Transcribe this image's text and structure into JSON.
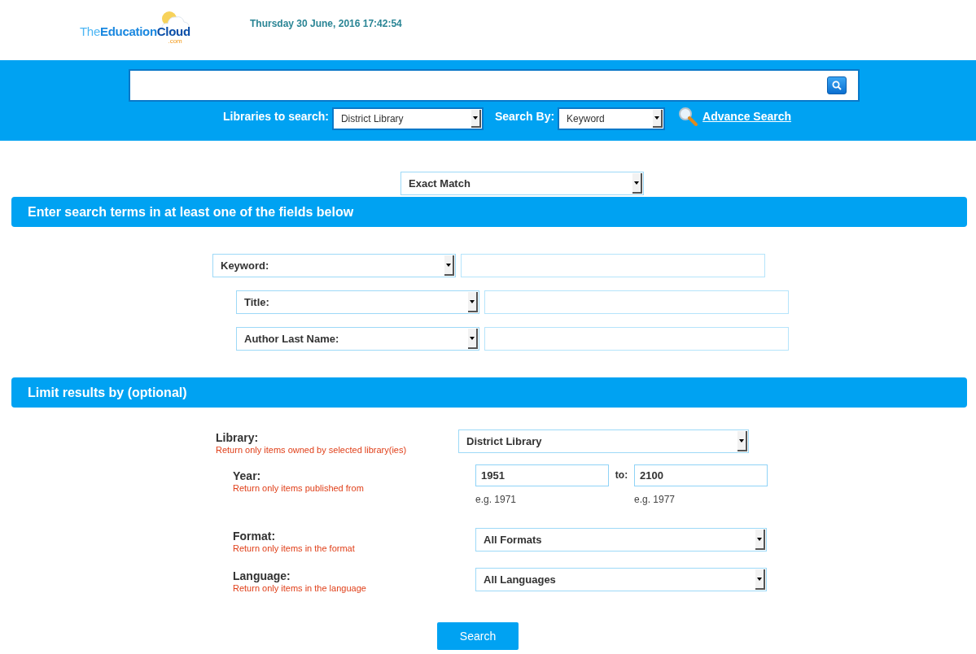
{
  "header": {
    "logo": {
      "parts": [
        "The",
        "Education",
        "Cloud"
      ],
      "suffix": ".com"
    },
    "datetime": "Thursday 30 June, 2016 17:42:54"
  },
  "search_bar": {
    "libraries_label": "Libraries to search:",
    "libraries_value": "District Library",
    "search_by_label": "Search By:",
    "search_by_value": "Keyword",
    "advance_search_link": "Advance Search"
  },
  "match_mode": "Exact Match",
  "terms_section": {
    "title": "Enter search terms in at least one of the fields below",
    "fields": [
      {
        "field": "Keyword:"
      },
      {
        "field": "Title:"
      },
      {
        "field": "Author Last Name:"
      }
    ]
  },
  "limits_section": {
    "title": "Limit results by (optional)",
    "rows": [
      {
        "kind": "select",
        "label": "Library:",
        "hint": "Return only items owned by selected library(ies)",
        "value": "District Library"
      },
      {
        "kind": "range",
        "label": "Year:",
        "hint": "Return only items published from",
        "from": "1951",
        "separator": "to:",
        "to": "2100",
        "from_example": "e.g. 1971",
        "to_example": "e.g. 1977"
      },
      {
        "kind": "select",
        "label": "Format:",
        "hint": "Return only items in the format",
        "value": "All Formats"
      },
      {
        "kind": "select",
        "label": "Language:",
        "hint": "Return only items in the language",
        "value": "All Languages"
      }
    ]
  },
  "submit_button": "Search"
}
